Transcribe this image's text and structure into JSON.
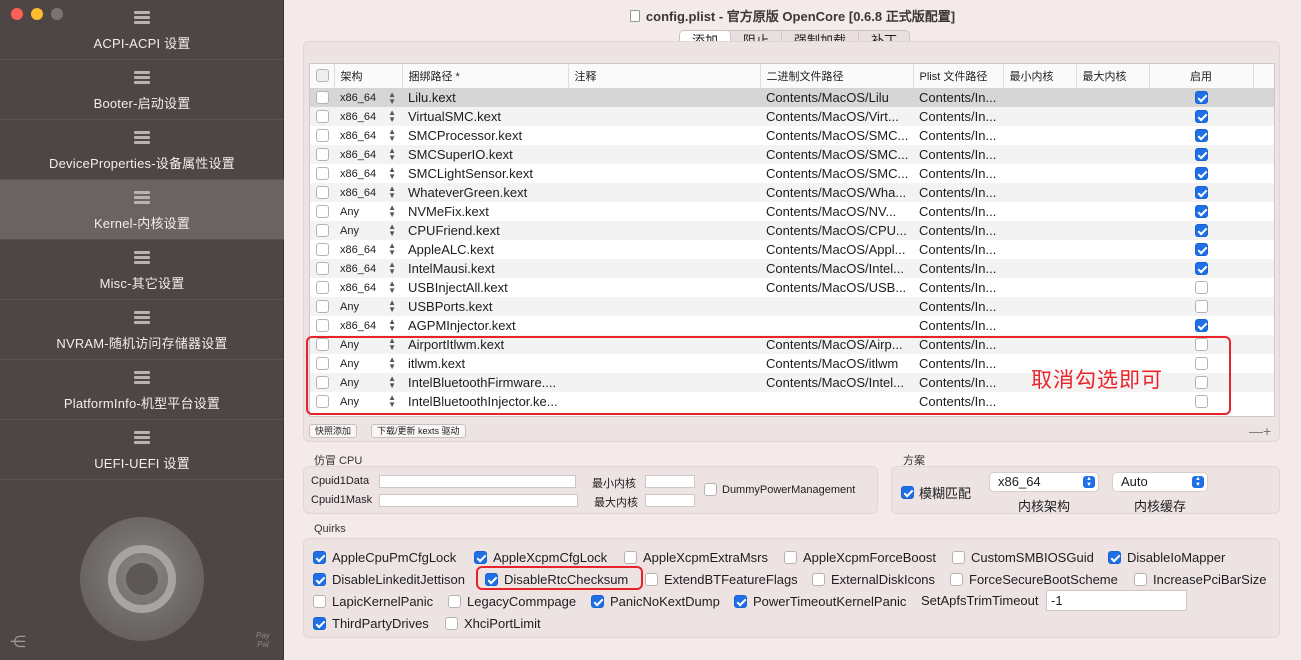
{
  "window": {
    "title": "config.plist - 官方原版 OpenCore [0.6.8 正式版配置]"
  },
  "sidebar": {
    "items": [
      {
        "label": "ACPI-ACPI 设置",
        "active": false
      },
      {
        "label": "Booter-启动设置",
        "active": false
      },
      {
        "label": "DeviceProperties-设备属性设置",
        "active": false
      },
      {
        "label": "Kernel-内核设置",
        "active": true
      },
      {
        "label": "Misc-其它设置",
        "active": false
      },
      {
        "label": "NVRAM-随机访问存储器设置",
        "active": false
      },
      {
        "label": "PlatformInfo-机型平台设置",
        "active": false
      },
      {
        "label": "UEFI-UEFI 设置",
        "active": false
      }
    ],
    "footer_logo": "Pay Pal"
  },
  "tabs": [
    {
      "label": "添加",
      "active": true
    },
    {
      "label": "阻止",
      "active": false
    },
    {
      "label": "强制加载",
      "active": false
    },
    {
      "label": "补丁",
      "active": false
    }
  ],
  "table": {
    "headers": [
      "架构",
      "捆绑路径 *",
      "注释",
      "二进制文件路径",
      "Plist 文件路径",
      "最小内核",
      "最大内核",
      "启用"
    ],
    "rows": [
      {
        "arch": "x86_64",
        "bundle": "Lilu.kext",
        "comment": "",
        "exec": "Contents/MacOS/Lilu",
        "plist": "Contents/In...",
        "min": "",
        "max": "",
        "enabled": true
      },
      {
        "arch": "x86_64",
        "bundle": "VirtualSMC.kext",
        "comment": "",
        "exec": "Contents/MacOS/Virt...",
        "plist": "Contents/In...",
        "min": "",
        "max": "",
        "enabled": true
      },
      {
        "arch": "x86_64",
        "bundle": "SMCProcessor.kext",
        "comment": "",
        "exec": "Contents/MacOS/SMC...",
        "plist": "Contents/In...",
        "min": "",
        "max": "",
        "enabled": true
      },
      {
        "arch": "x86_64",
        "bundle": "SMCSuperIO.kext",
        "comment": "",
        "exec": "Contents/MacOS/SMC...",
        "plist": "Contents/In...",
        "min": "",
        "max": "",
        "enabled": true
      },
      {
        "arch": "x86_64",
        "bundle": "SMCLightSensor.kext",
        "comment": "",
        "exec": "Contents/MacOS/SMC...",
        "plist": "Contents/In...",
        "min": "",
        "max": "",
        "enabled": true
      },
      {
        "arch": "x86_64",
        "bundle": "WhateverGreen.kext",
        "comment": "",
        "exec": "Contents/MacOS/Wha...",
        "plist": "Contents/In...",
        "min": "",
        "max": "",
        "enabled": true
      },
      {
        "arch": "Any",
        "bundle": "NVMeFix.kext",
        "comment": "",
        "exec": "Contents/MacOS/NV...",
        "plist": "Contents/In...",
        "min": "",
        "max": "",
        "enabled": true
      },
      {
        "arch": "Any",
        "bundle": "CPUFriend.kext",
        "comment": "",
        "exec": "Contents/MacOS/CPU...",
        "plist": "Contents/In...",
        "min": "",
        "max": "",
        "enabled": true
      },
      {
        "arch": "x86_64",
        "bundle": "AppleALC.kext",
        "comment": "",
        "exec": "Contents/MacOS/Appl...",
        "plist": "Contents/In...",
        "min": "",
        "max": "",
        "enabled": true
      },
      {
        "arch": "x86_64",
        "bundle": "IntelMausi.kext",
        "comment": "",
        "exec": "Contents/MacOS/Intel...",
        "plist": "Contents/In...",
        "min": "",
        "max": "",
        "enabled": true
      },
      {
        "arch": "x86_64",
        "bundle": "USBInjectAll.kext",
        "comment": "",
        "exec": "Contents/MacOS/USB...",
        "plist": "Contents/In...",
        "min": "",
        "max": "",
        "enabled": false
      },
      {
        "arch": "Any",
        "bundle": "USBPorts.kext",
        "comment": "",
        "exec": "",
        "plist": "Contents/In...",
        "min": "",
        "max": "",
        "enabled": false
      },
      {
        "arch": "x86_64",
        "bundle": "AGPMInjector.kext",
        "comment": "",
        "exec": "",
        "plist": "Contents/In...",
        "min": "",
        "max": "",
        "enabled": true
      },
      {
        "arch": "Any",
        "bundle": "AirportItlwm.kext",
        "comment": "",
        "exec": "Contents/MacOS/Airp...",
        "plist": "Contents/In...",
        "min": "",
        "max": "",
        "enabled": false
      },
      {
        "arch": "Any",
        "bundle": "itlwm.kext",
        "comment": "",
        "exec": "Contents/MacOS/itlwm",
        "plist": "Contents/In...",
        "min": "",
        "max": "",
        "enabled": false
      },
      {
        "arch": "Any",
        "bundle": "IntelBluetoothFirmware....",
        "comment": "",
        "exec": "Contents/MacOS/Intel...",
        "plist": "Contents/In...",
        "min": "",
        "max": "",
        "enabled": false
      },
      {
        "arch": "Any",
        "bundle": "IntelBluetoothInjector.ke...",
        "comment": "",
        "exec": "",
        "plist": "Contents/In...",
        "min": "",
        "max": "",
        "enabled": false
      }
    ]
  },
  "table_buttons": {
    "snapshot": "快照添加",
    "download": "下载/更新 kexts 驱动",
    "plus_minus": "—+"
  },
  "annotation": "取消勾选即可",
  "cpuid": {
    "title": "仿冒 CPU",
    "data_label": "Cpuid1Data",
    "data_value": "",
    "mask_label": "Cpuid1Mask",
    "mask_value": "",
    "min_kernel_label": "最小内核",
    "min_kernel_value": "",
    "max_kernel_label": "最大内核",
    "max_kernel_value": "",
    "dummy_label": "DummyPowerManagement",
    "dummy_checked": false
  },
  "scheme": {
    "title": "方案",
    "fuzzy_label": "模糊匹配",
    "fuzzy_checked": true,
    "arch_value": "x86_64",
    "arch_caption": "内核架构",
    "cache_value": "Auto",
    "cache_caption": "内核缓存"
  },
  "quirks": {
    "title": "Quirks",
    "items": [
      {
        "label": "AppleCpuPmCfgLock",
        "checked": true
      },
      {
        "label": "AppleXcpmCfgLock",
        "checked": true
      },
      {
        "label": "AppleXcpmExtraMsrs",
        "checked": false
      },
      {
        "label": "AppleXcpmForceBoost",
        "checked": false
      },
      {
        "label": "CustomSMBIOSGuid",
        "checked": false
      },
      {
        "label": "DisableIoMapper",
        "checked": true
      },
      {
        "label": "DisableLinkeditJettison",
        "checked": true
      },
      {
        "label": "DisableRtcChecksum",
        "checked": true
      },
      {
        "label": "ExtendBTFeatureFlags",
        "checked": false
      },
      {
        "label": "ExternalDiskIcons",
        "checked": false
      },
      {
        "label": "ForceSecureBootScheme",
        "checked": false
      },
      {
        "label": "IncreasePciBarSize",
        "checked": false
      },
      {
        "label": "LapicKernelPanic",
        "checked": false
      },
      {
        "label": "LegacyCommpage",
        "checked": false
      },
      {
        "label": "PanicNoKextDump",
        "checked": true
      },
      {
        "label": "PowerTimeoutKernelPanic",
        "checked": true
      },
      {
        "label": "ThirdPartyDrives",
        "checked": true
      },
      {
        "label": "XhciPortLimit",
        "checked": false
      }
    ],
    "apfs_label": "SetApfsTrimTimeout",
    "apfs_value": "-1"
  },
  "colors": {
    "accent": "#1f6fe6",
    "highlight": "#e8242a",
    "sidebar": "#4e4545"
  }
}
